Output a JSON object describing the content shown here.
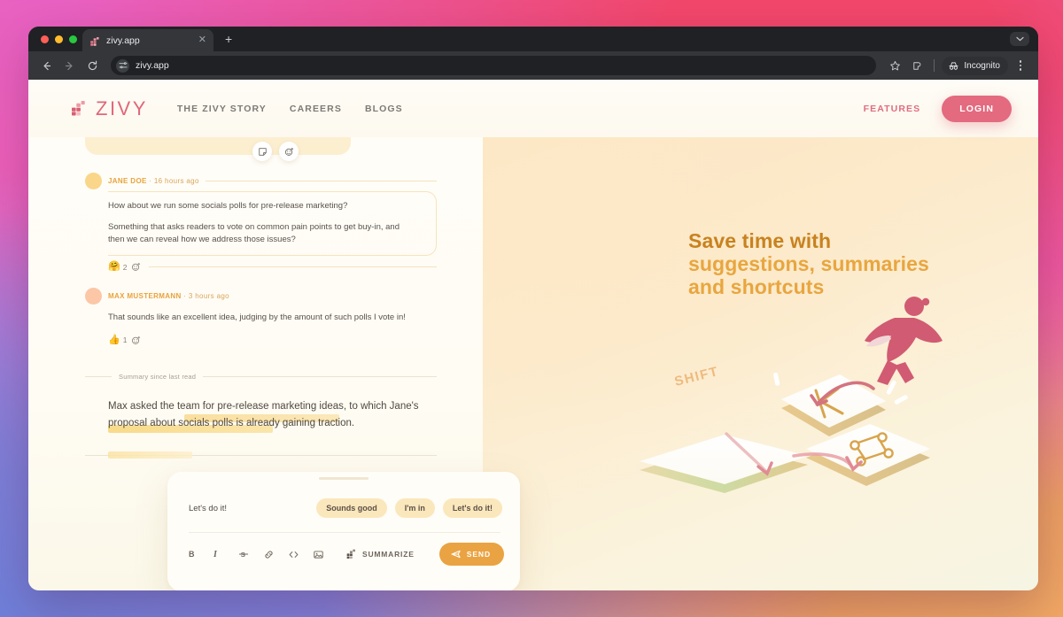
{
  "browser": {
    "tab_title": "zivy.app",
    "tab_favicon_icon": "zivy-favicon-icon",
    "tab_close_icon": "close-icon",
    "new_tab_icon": "plus-icon",
    "window_caret_icon": "chevron-down-icon",
    "back_icon": "back-arrow-icon",
    "forward_icon": "forward-arrow-icon",
    "reload_icon": "reload-icon",
    "site_settings_icon": "tune-icon",
    "url": "zivy.app",
    "bookmark_icon": "star-icon",
    "extensions_icon": "extensions-icon",
    "incognito_label": "Incognito",
    "incognito_icon": "incognito-hat-icon",
    "menu_icon": "kebab-menu-icon"
  },
  "nav": {
    "brand": "ZIVY",
    "brand_icon": "zivy-logo-icon",
    "links": [
      {
        "label": "THE ZIVY STORY"
      },
      {
        "label": "CAREERS"
      },
      {
        "label": "BLOGS"
      }
    ],
    "features_label": "FEATURES",
    "login_label": "LOGIN"
  },
  "chat": {
    "top_actions": [
      {
        "icon": "note-icon"
      },
      {
        "icon": "add-reaction-icon"
      }
    ],
    "messages": [
      {
        "author": "JANE DOE",
        "separator": " · ",
        "time": "16 hours ago",
        "paragraphs": [
          "How about we run some socials polls for pre-release marketing?",
          "Something that asks readers to vote on common pain points to get buy-in, and then we can reveal how we address those issues?"
        ],
        "reactions": [
          {
            "emoji": "🤗",
            "count": "2"
          }
        ],
        "add_reaction_icon": "add-reaction-icon"
      },
      {
        "author": "MAX MUSTERMANN",
        "separator": " · ",
        "time": "3 hours ago",
        "paragraphs": [
          "That sounds like an excellent idea, judging by the amount of such polls I vote in!"
        ],
        "reactions": [
          {
            "emoji": "👍",
            "count": "1"
          }
        ],
        "add_reaction_icon": "add-reaction-icon"
      }
    ],
    "summary_label": "Summary since last read",
    "summary_text": "Max asked the team for pre-release marketing ideas, to which Jane's proposal about socials polls is already gaining traction."
  },
  "composer": {
    "draft_text": "Let's do it!",
    "suggestions": [
      {
        "label": "Sounds good"
      },
      {
        "label": "I'm in"
      },
      {
        "label": "Let's do it!"
      }
    ],
    "tools": [
      {
        "label": "B",
        "icon": "bold-icon"
      },
      {
        "label": "I",
        "icon": "italic-icon"
      },
      {
        "label": "S",
        "icon": "strikethrough-icon"
      },
      {
        "label": "",
        "icon": "link-icon"
      },
      {
        "label": "",
        "icon": "code-icon"
      },
      {
        "label": "",
        "icon": "image-icon"
      }
    ],
    "summarize_label": "SUMMARIZE",
    "summarize_icon": "zivy-logo-icon",
    "send_label": "SEND",
    "send_icon": "send-paper-plane-icon"
  },
  "hero": {
    "title_line1": "Save time with",
    "title_line2": "suggestions, summaries",
    "title_line3": "and shortcuts",
    "illustration_icon": "keyboard-shortcut-illustration",
    "key_shift_label": "SHIFT",
    "key_k_label": "K",
    "key_cmd_label": "⌘"
  },
  "colors": {
    "brand_pink": "#e0677a",
    "login_pink": "#e36a7f",
    "accent_orange": "#eaa342",
    "title_dark": "#c8821f",
    "title_light": "#e8a63f",
    "chip_bg": "#fbe7bc"
  }
}
